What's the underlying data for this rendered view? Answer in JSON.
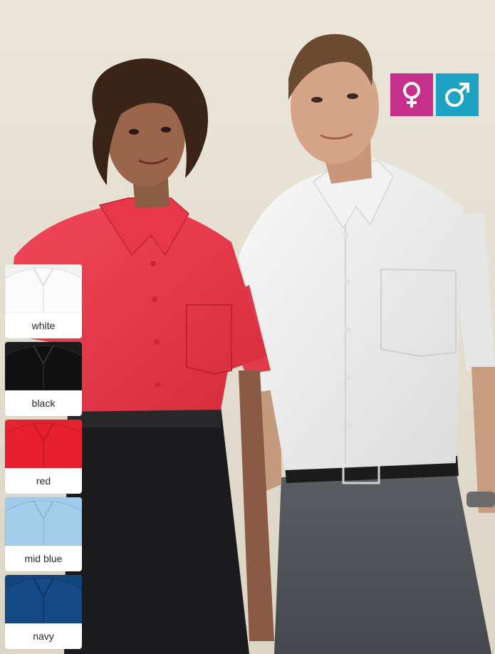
{
  "gender_icons": [
    {
      "icon": "female-symbol-icon",
      "color": "#c5308c"
    },
    {
      "icon": "male-symbol-icon",
      "color": "#1fa3c5"
    }
  ],
  "swatches": [
    {
      "label": "white",
      "color": "#f7f7f7"
    },
    {
      "label": "black",
      "color": "#161616"
    },
    {
      "label": "red",
      "color": "#e3232f"
    },
    {
      "label": "mid blue",
      "color": "#9ecbe9"
    },
    {
      "label": "navy",
      "color": "#13447b"
    }
  ]
}
